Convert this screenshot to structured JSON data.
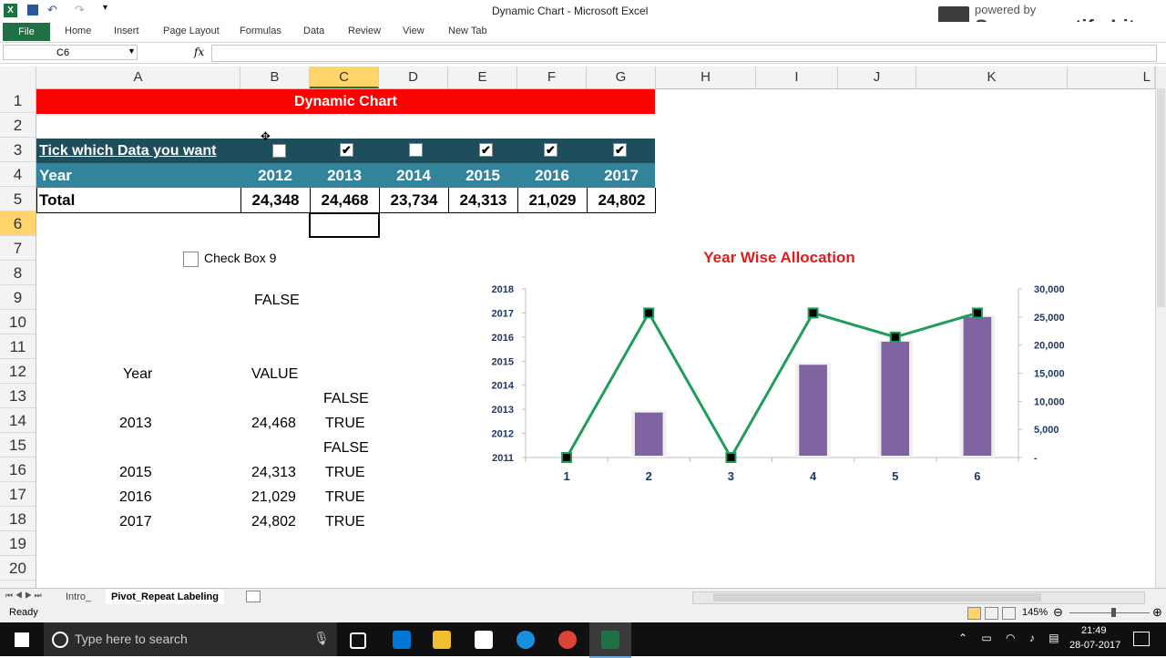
{
  "window": {
    "title": "Dynamic Chart  -  Microsoft Excel",
    "watermark_top": "powered by",
    "watermark_brand": "Screencastify Lite"
  },
  "ribbon": {
    "tabs": [
      "File",
      "Home",
      "Insert",
      "Page Layout",
      "Formulas",
      "Data",
      "Review",
      "View",
      "New Tab"
    ]
  },
  "formula_bar": {
    "name_box": "C6",
    "fx": "fx",
    "value": ""
  },
  "columns": [
    "A",
    "B",
    "C",
    "D",
    "E",
    "F",
    "G",
    "H",
    "I",
    "J",
    "K",
    "L"
  ],
  "rows": [
    "1",
    "2",
    "3",
    "4",
    "5",
    "6",
    "7",
    "8",
    "9",
    "10",
    "11",
    "12",
    "13",
    "14",
    "15",
    "16",
    "17",
    "18",
    "19",
    "20"
  ],
  "sheet": {
    "banner": "Dynamic Chart",
    "tick_label": "Tick which Data you want",
    "checks": [
      false,
      true,
      false,
      true,
      true,
      true
    ],
    "year_label": "Year",
    "years": [
      "2012",
      "2013",
      "2014",
      "2015",
      "2016",
      "2017"
    ],
    "total_label": "Total",
    "totals": [
      "24,348",
      "24,468",
      "23,734",
      "24,313",
      "21,029",
      "24,802"
    ],
    "checkbox9_label": "Check  Box 9",
    "false_cell": "FALSE",
    "table_head": {
      "year": "Year",
      "value": "VALUE"
    },
    "table_rows": [
      {
        "year": "",
        "value": "",
        "flag": "FALSE"
      },
      {
        "year": "2013",
        "value": "24,468",
        "flag": "TRUE"
      },
      {
        "year": "",
        "value": "",
        "flag": "FALSE"
      },
      {
        "year": "2015",
        "value": "24,313",
        "flag": "TRUE"
      },
      {
        "year": "2016",
        "value": "21,029",
        "flag": "TRUE"
      },
      {
        "year": "2017",
        "value": "24,802",
        "flag": "TRUE"
      }
    ]
  },
  "chart_data": {
    "type": "bar",
    "title": "Year Wise Allocation",
    "categories": [
      "1",
      "2",
      "3",
      "4",
      "5",
      "6"
    ],
    "series": [
      {
        "kind": "bar",
        "axis": "right",
        "color": "#8064a2",
        "values": [
          0,
          8000,
          0,
          16500,
          20600,
          25000
        ]
      },
      {
        "kind": "line",
        "axis": "left",
        "color": "#1e9e5a",
        "values": [
          2011,
          2017.0,
          2011,
          2017.0,
          2016.0,
          2017.0
        ]
      }
    ],
    "left_axis": {
      "min": 2011,
      "max": 2018,
      "ticks": [
        "2011",
        "2012",
        "2013",
        "2014",
        "2015",
        "2016",
        "2017",
        "2018"
      ]
    },
    "right_axis": {
      "min": 0,
      "max": 30000,
      "ticks": [
        "-",
        "5,000",
        "10,000",
        "15,000",
        "20,000",
        "25,000",
        "30,000"
      ]
    },
    "title_color": "#e31b1b",
    "grid": false
  },
  "sheet_tabs": [
    "Intro_",
    "Pivot_Repeat Labeling"
  ],
  "status": {
    "ready": "Ready",
    "zoom": "145%"
  },
  "taskbar": {
    "search_placeholder": "Type here to search",
    "time": "21:49",
    "date": "28-07-2017"
  }
}
